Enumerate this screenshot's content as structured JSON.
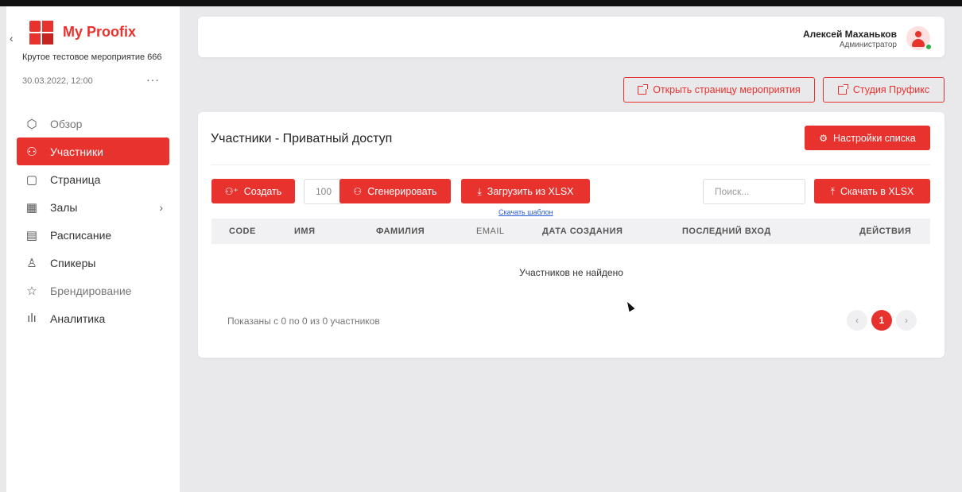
{
  "sidebar": {
    "brand": "My Proofix",
    "event_name": "Крутое тестовое мероприятие 666",
    "event_date": "30.03.2022, 12:00",
    "more_glyph": "···",
    "collapse_glyph": "‹",
    "items": [
      {
        "label": "Обзор",
        "icon": "cube-icon",
        "glyph": "⬡",
        "active": false
      },
      {
        "label": "Участники",
        "icon": "users-icon",
        "glyph": "⚇",
        "active": true
      },
      {
        "label": "Страница",
        "icon": "page-icon",
        "glyph": "▢",
        "active": false
      },
      {
        "label": "Залы",
        "icon": "halls-icon",
        "glyph": "▦",
        "active": false,
        "chevron": "›"
      },
      {
        "label": "Расписание",
        "icon": "calendar-icon",
        "glyph": "▤",
        "active": false
      },
      {
        "label": "Спикеры",
        "icon": "speaker-icon",
        "glyph": "♙",
        "active": false
      },
      {
        "label": "Брендирование",
        "icon": "star-icon",
        "glyph": "☆",
        "active": false
      },
      {
        "label": "Аналитика",
        "icon": "analytics-icon",
        "glyph": "ılı",
        "active": false
      }
    ]
  },
  "header": {
    "user_name": "Алексей Маханьков",
    "user_role": "Администратор",
    "online_color": "#2bb24c"
  },
  "actions": {
    "open_event_page": "Открыть страницу мероприятия",
    "studio": "Студия Пруфикс"
  },
  "card": {
    "title": "Участники - Приватный доступ",
    "settings_label": "Настройки списка",
    "create_label": "Создать",
    "count_value": "100",
    "generate_label": "Сгенерировать",
    "upload_label": "Загрузить из XLSX",
    "template_link": "Скачать шаблон",
    "search_placeholder": "Поиск...",
    "download_label": "Скачать в XLSX",
    "columns": [
      "CODE",
      "ИМЯ",
      "ФАМИЛИЯ",
      "EMAIL",
      "ДАТА СОЗДАНИЯ",
      "ПОСЛЕДНИЙ ВХОД",
      "ДЕЙСТВИЯ"
    ],
    "empty_message": "Участников не найдено",
    "page_info": "Показаны с 0 по 0 из 0 участников",
    "current_page": "1",
    "prev_glyph": "‹",
    "next_glyph": "›"
  },
  "colors": {
    "accent": "#e8322e",
    "background": "#e9e9ec",
    "link": "#2a5bd7"
  }
}
